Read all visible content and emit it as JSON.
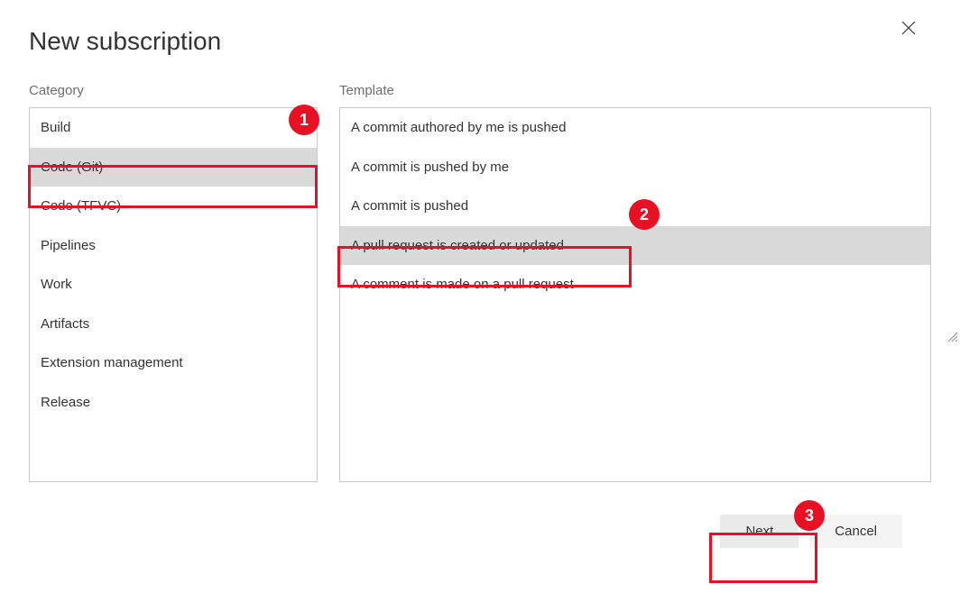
{
  "title": "New subscription",
  "labels": {
    "category": "Category",
    "template": "Template"
  },
  "categories": [
    {
      "label": "Build",
      "selected": false
    },
    {
      "label": "Code (Git)",
      "selected": true
    },
    {
      "label": "Code (TFVC)",
      "selected": false
    },
    {
      "label": "Pipelines",
      "selected": false
    },
    {
      "label": "Work",
      "selected": false
    },
    {
      "label": "Artifacts",
      "selected": false
    },
    {
      "label": "Extension management",
      "selected": false
    },
    {
      "label": "Release",
      "selected": false
    }
  ],
  "templates": [
    {
      "label": "A commit authored by me is pushed",
      "selected": false
    },
    {
      "label": "A commit is pushed by me",
      "selected": false
    },
    {
      "label": "A commit is pushed",
      "selected": false
    },
    {
      "label": "A pull request is created or updated",
      "selected": true
    },
    {
      "label": "A comment is made on a pull request",
      "selected": false
    }
  ],
  "buttons": {
    "next": "Next",
    "cancel": "Cancel"
  },
  "annotations": {
    "n1": "1",
    "n2": "2",
    "n3": "3"
  }
}
